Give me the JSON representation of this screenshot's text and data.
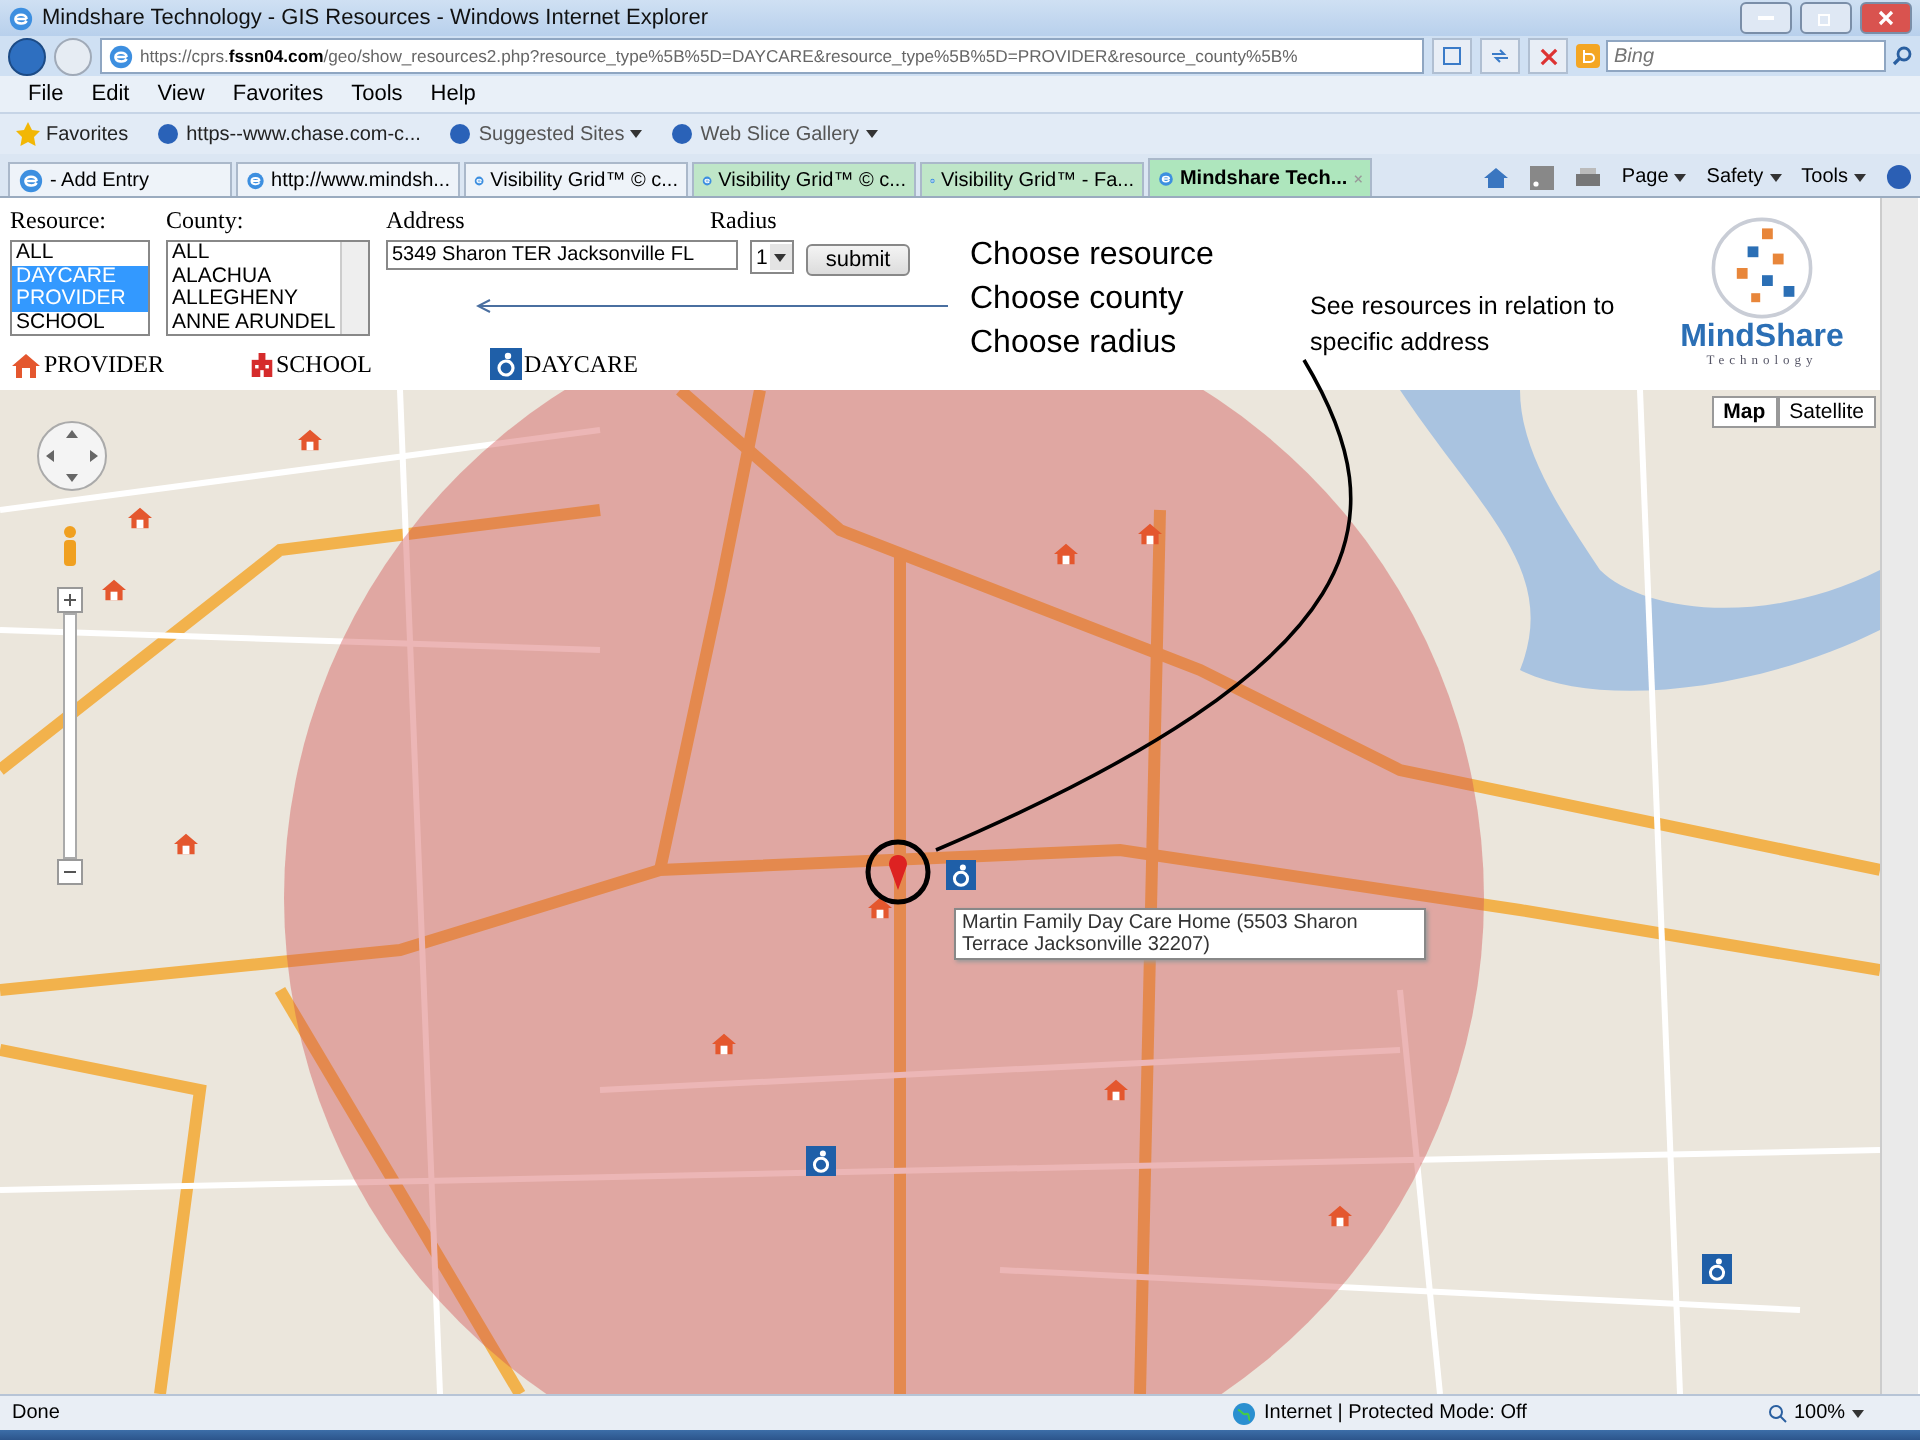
{
  "window": {
    "title": "Mindshare Technology - GIS Resources - Windows Internet Explorer"
  },
  "address_bar": {
    "url": "https://cprs.**fssn04.com**/geo/show_resources2.php?resource_type%5B%5D=DAYCARE&resource_type%5B%5D=PROVIDER&resource_county%5B%"
  },
  "search": {
    "placeholder": "Bing"
  },
  "menu": [
    "File",
    "Edit",
    "View",
    "Favorites",
    "Tools",
    "Help"
  ],
  "favorites_bar": {
    "label": "Favorites",
    "items": [
      {
        "label": "https--www.chase.com-c...",
        "dropdown": false
      },
      {
        "label": "Suggested Sites",
        "dropdown": true
      },
      {
        "label": "Web Slice Gallery",
        "dropdown": true
      }
    ]
  },
  "tabs": [
    {
      "label": "- Add Entry",
      "selected": false,
      "grouped": false
    },
    {
      "label": "http://www.mindsh...",
      "selected": false,
      "grouped": false
    },
    {
      "label": "Visibility Grid™ © c...",
      "selected": false,
      "grouped": false
    },
    {
      "label": "Visibility Grid™ © c...",
      "selected": false,
      "grouped": true
    },
    {
      "label": "Visibility Grid™ - Fa...",
      "selected": false,
      "grouped": true
    },
    {
      "label": "Mindshare Tech...",
      "selected": true,
      "grouped": true
    }
  ],
  "command_bar": [
    "Page",
    "Safety",
    "Tools"
  ],
  "form": {
    "resource": {
      "label": "Resource:",
      "options": [
        {
          "label": "ALL",
          "selected": false
        },
        {
          "label": "DAYCARE",
          "selected": true
        },
        {
          "label": "PROVIDER",
          "selected": true
        },
        {
          "label": "SCHOOL",
          "selected": false
        }
      ]
    },
    "county": {
      "label": "County:",
      "options": [
        "ALL",
        "ALACHUA",
        "ALLEGHENY",
        "ANNE ARUNDEL"
      ]
    },
    "address": {
      "label": "Address",
      "value": "5349 Sharon TER Jacksonville FL"
    },
    "radius": {
      "label": "Radius",
      "value": "1"
    },
    "submit": "submit"
  },
  "legend": [
    {
      "kind": "provider",
      "label": "PROVIDER"
    },
    {
      "kind": "school",
      "label": "SCHOOL"
    },
    {
      "kind": "daycare",
      "label": "DAYCARE"
    }
  ],
  "instructions": [
    "Choose resource",
    "Choose county",
    "Choose radius"
  ],
  "callout": "See resources in relation to specific address",
  "logo": {
    "name": "MindShare",
    "tagline": "Technology"
  },
  "map": {
    "type_buttons": [
      {
        "label": "Map",
        "selected": true
      },
      {
        "label": "Satellite",
        "selected": false
      }
    ],
    "tooltip": "Martin Family Day Care Home (5503 Sharon Terrace Jacksonville 32207)"
  },
  "status_bar": {
    "text": "Done",
    "zone": "Internet | Protected Mode: Off",
    "zoom": "100%"
  }
}
